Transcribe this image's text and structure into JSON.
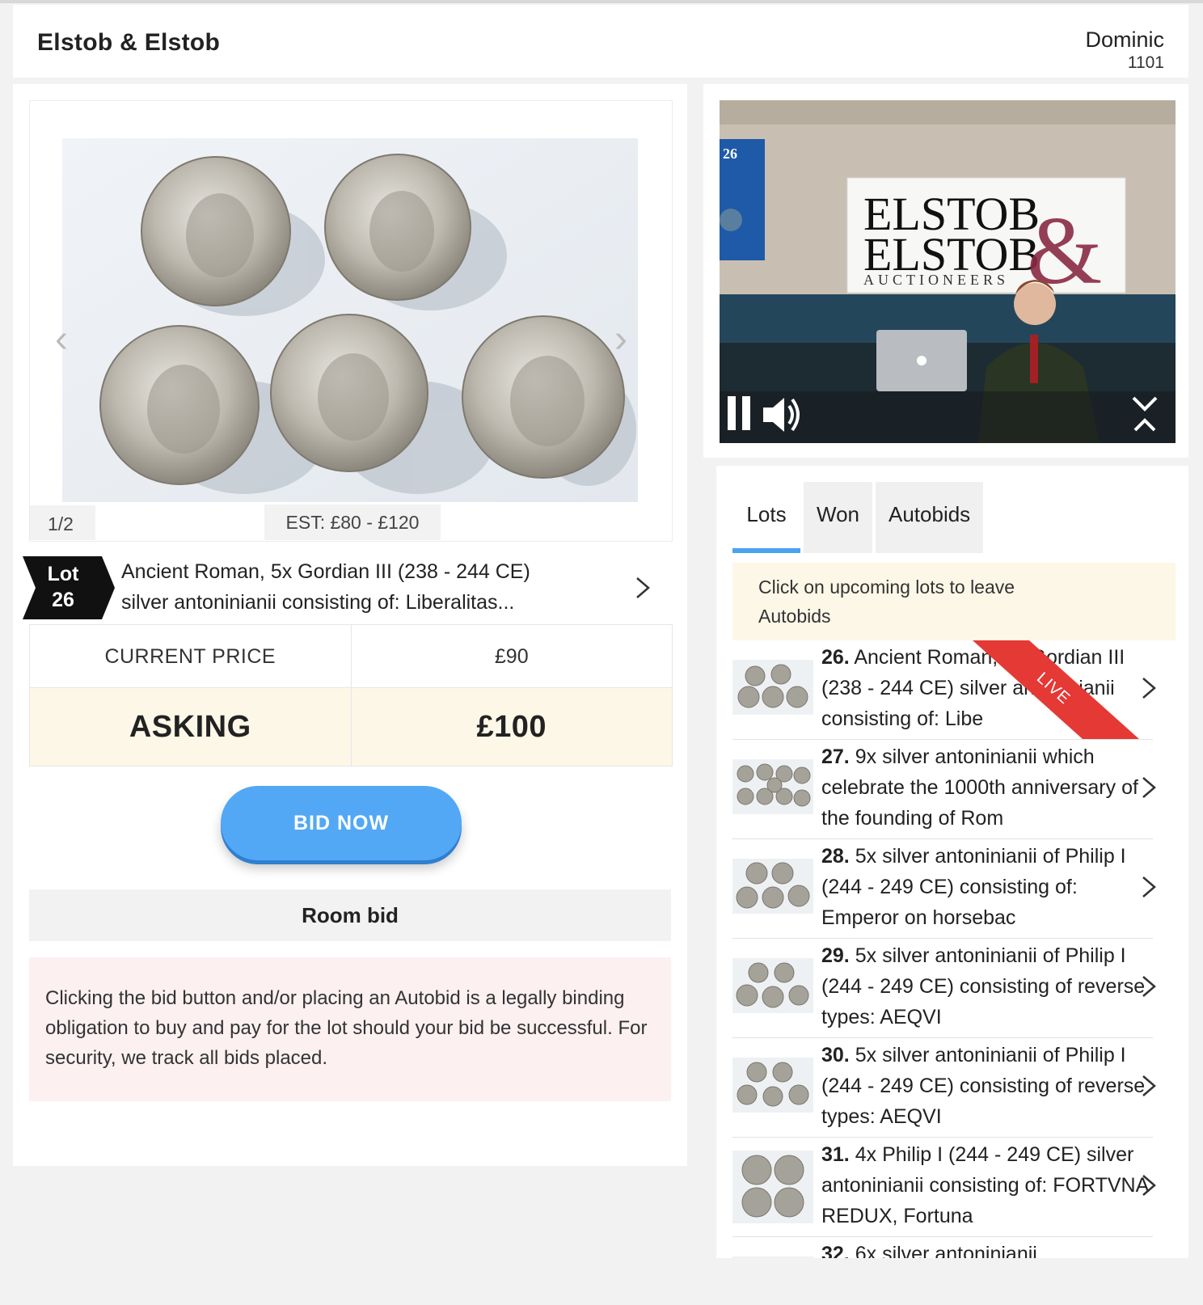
{
  "header": {
    "brand": "Elstob & Elstob",
    "user_name": "Dominic",
    "user_id": "1101"
  },
  "lot": {
    "image_counter": "1/2",
    "estimate": "EST: £80 - £120",
    "tag_label": "Lot",
    "tag_number": "26",
    "title_line1": "Ancient Roman, 5x Gordian III (238 - 244 CE)",
    "title_line2": "silver antoninianii consisting of: Liberalitas..."
  },
  "pricing": {
    "current_label": "CURRENT PRICE",
    "current_value": "£90",
    "asking_label": "ASKING",
    "asking_value": "£100"
  },
  "bid_button": "BID NOW",
  "room_bid": "Room bid",
  "legal_text": "Clicking the bid button and/or placing an Autobid is a legally binding obligation to buy and pay for the lot should your bid be successful. For security, we track all bids placed.",
  "video": {
    "screen_number": "26",
    "sign_line1": "ELSTOB",
    "sign_line2": "ELSTOB",
    "sign_ampersand": "&",
    "sign_subtitle": "AUCTIONEERS"
  },
  "tabs": [
    {
      "label": "Lots"
    },
    {
      "label": "Won"
    },
    {
      "label": "Autobids"
    }
  ],
  "autobid_note_line1": "Click on upcoming lots to leave",
  "autobid_note_line2": "Autobids",
  "live_label": "LIVE",
  "lots": [
    {
      "number": "26.",
      "text": "Ancient Roman, 5x Gordian III (238 - 244 CE) silver antoninianii consisting of: Libe"
    },
    {
      "number": "27.",
      "text": "9x silver antoninianii which celebrate the 1000th anniversary of the founding of Rom"
    },
    {
      "number": "28.",
      "text": "5x silver antoninianii of Philip I (244 - 249 CE) consisting of: Emperor on horsebac"
    },
    {
      "number": "29.",
      "text": "5x silver antoninianii of Philip I (244 - 249 CE) consisting of reverse types: AEQVI"
    },
    {
      "number": "30.",
      "text": "5x silver antoninianii of Philip I (244 - 249 CE) consisting of reverse types: AEQVI"
    },
    {
      "number": "31.",
      "text": "4x Philip I (244 - 249 CE) silver antoninianii consisting of: FORTVNA REDUX, Fortuna"
    },
    {
      "number": "32.",
      "text": "6x silver antoninianii"
    }
  ],
  "colors": {
    "accent_blue": "#52a8f5",
    "live_red": "#e53935",
    "asking_bg": "#fdf7e8",
    "legal_bg": "#fcf0f1"
  }
}
